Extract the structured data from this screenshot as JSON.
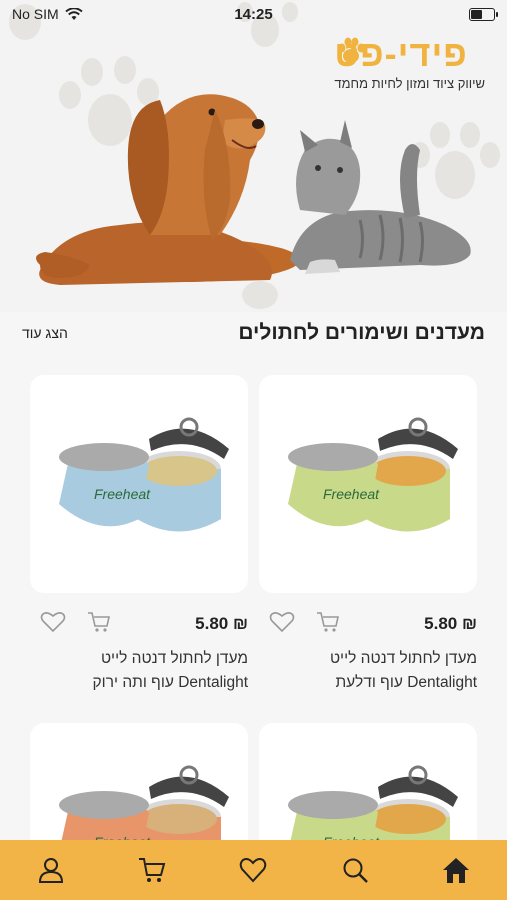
{
  "status_bar": {
    "carrier": "No SIM",
    "time": "14:25"
  },
  "brand": {
    "name": "פידי-פט",
    "tagline": "שיווק ציוד ומזון לחיות מחמד"
  },
  "section": {
    "title": "מעדנים ושימורים לחתולים",
    "show_more": "הצג עוד"
  },
  "products": [
    {
      "price": "5.80 ₪",
      "title": "מעדן לחתול דנטה לייט Dentalight עוף ודלעת",
      "label_color": "#c9d98a"
    },
    {
      "price": "5.80 ₪",
      "title": "מעדן לחתול דנטה לייט Dentalight עוף ותה ירוק",
      "label_color": "#a9cbe0"
    },
    {
      "price": "",
      "title": "",
      "label_color": "#c9d98a"
    },
    {
      "price": "",
      "title": "",
      "label_color": "#e8956a"
    }
  ],
  "can_brand": "Freeheat",
  "nav": [
    "home-icon",
    "search-icon",
    "heart-icon",
    "cart-icon",
    "user-icon"
  ],
  "colors": {
    "accent": "#f2b447",
    "brand": "#f0b33f"
  }
}
